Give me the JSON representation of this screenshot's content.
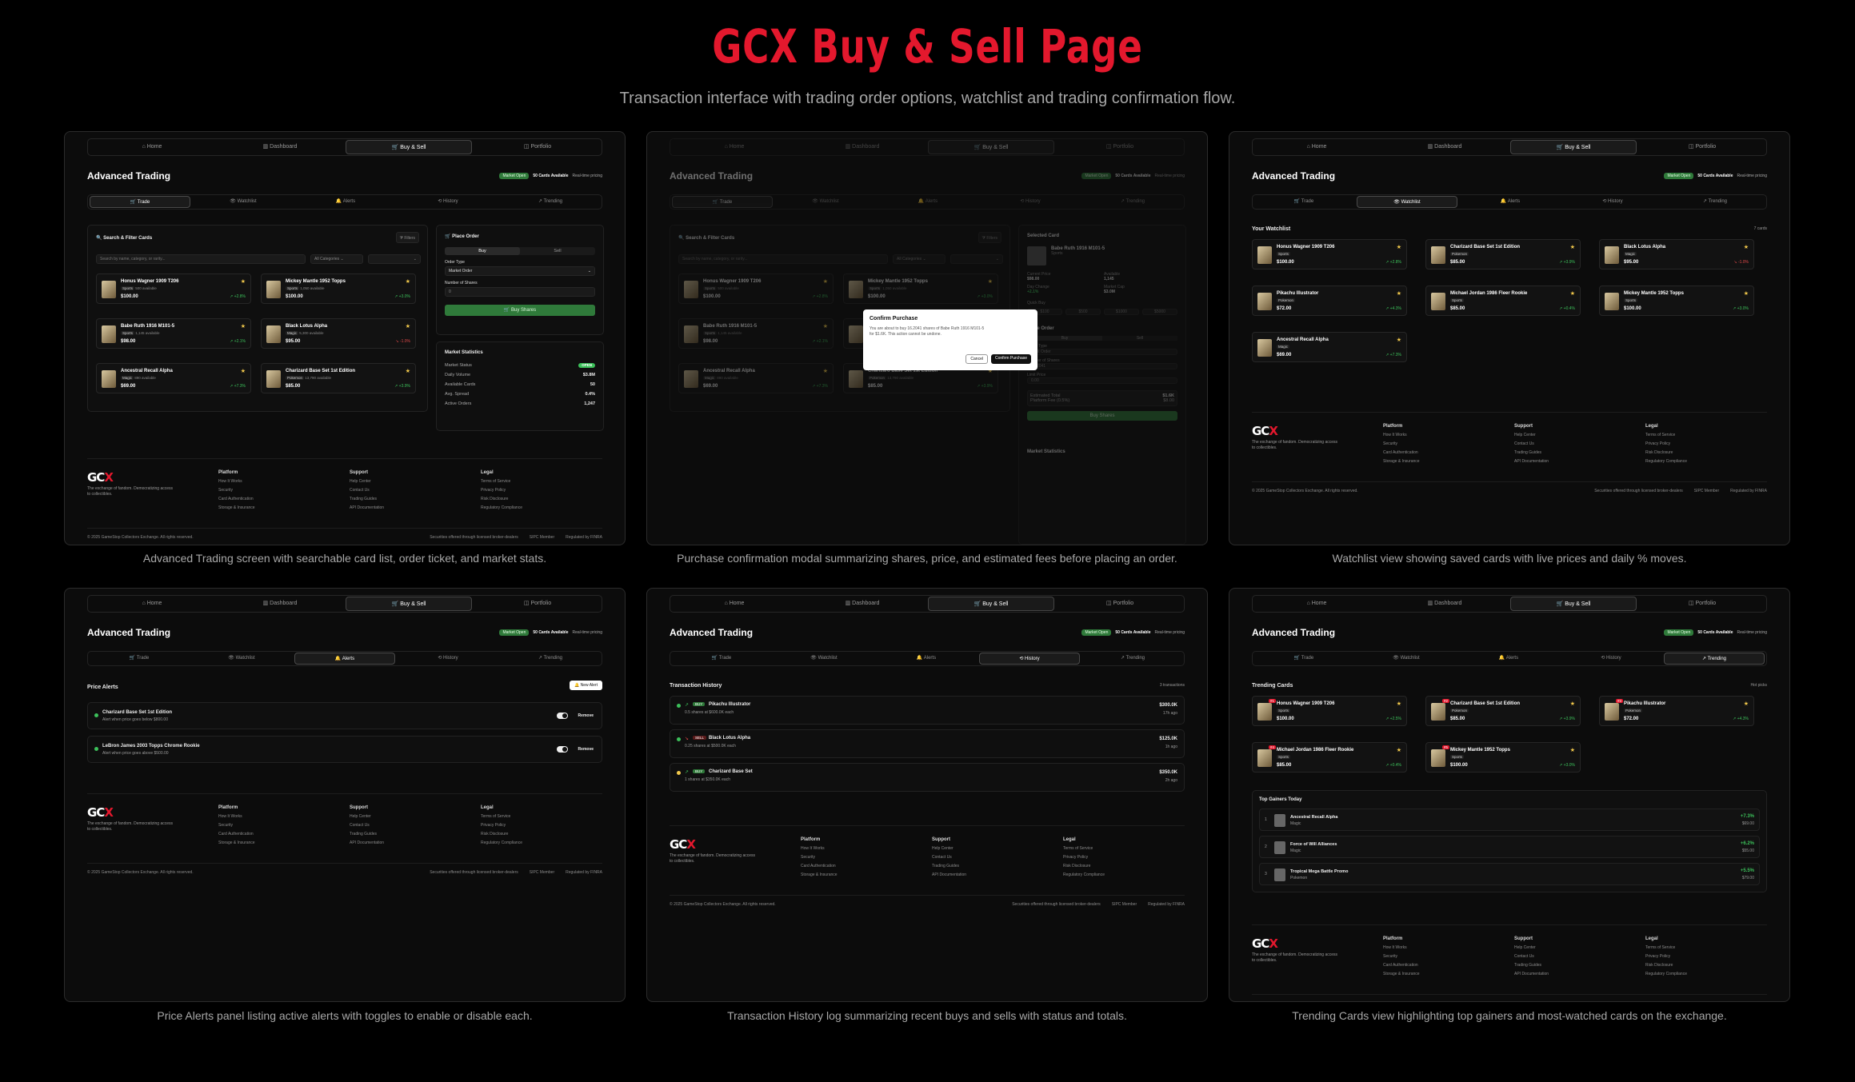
{
  "header": {
    "title": "GCX Buy & Sell Page",
    "subtitle": "Transaction interface with trading order options, watchlist and trading confirmation flow."
  },
  "nav": [
    "Home",
    "Dashboard",
    "Buy & Sell",
    "Portfolio"
  ],
  "tabs": [
    "Trade",
    "Watchlist",
    "Alerts",
    "History",
    "Trending"
  ],
  "page_title": "Advanced Trading",
  "chips": {
    "status": "Market Open",
    "cards": "50 Cards Available",
    "pricing": "Real-time pricing"
  },
  "captions": [
    "Advanced Trading screen with searchable card list, order ticket, and market stats.",
    "Purchase confirmation modal summarizing shares, price, and estimated fees before placing an order.",
    "Watchlist view showing saved cards with live prices and daily % moves.",
    "Price Alerts panel listing active alerts with toggles to enable or disable each.",
    "Transaction History log summarizing recent buys and sells with status and totals.",
    "Trending Cards view highlighting top gainers and most-watched cards on the exchange."
  ],
  "trade": {
    "search_title": "Search & Filter Cards",
    "filters": "Filters",
    "search_ph": "Search by name, category, or rarity...",
    "all_cat": "All Categories",
    "cards": [
      {
        "name": "Honus Wagner 1909 T206",
        "tag": "Sports",
        "avail": "500 available",
        "price": "$100.00",
        "chg": "↗ +2.8%"
      },
      {
        "name": "Mickey Mantle 1952 Topps",
        "tag": "Sports",
        "avail": "1,050 available",
        "price": "$100.00",
        "chg": "↗ +3.0%"
      },
      {
        "name": "Babe Ruth 1916 M101-5",
        "tag": "Sports",
        "avail": "1,145 available",
        "price": "$98.00",
        "chg": "↗ +2.1%"
      },
      {
        "name": "Black Lotus Alpha",
        "tag": "Magic",
        "avail": "5,300 available",
        "price": "$95.00",
        "chg": "↘ -1.0%"
      },
      {
        "name": "Ancestral Recall Alpha",
        "tag": "Magic",
        "avail": "890 available",
        "price": "$69.00",
        "chg": "↗ +7.3%"
      },
      {
        "name": "Charizard Base Set 1st Edition",
        "tag": "Pokemon",
        "avail": "13,790 available",
        "price": "$85.00",
        "chg": "↗ +3.9%"
      }
    ],
    "order_title": "Place Order",
    "buy": "Buy",
    "sell": "Sell",
    "order_type_label": "Order Type",
    "order_type": "Market Order",
    "shares_label": "Number of Shares",
    "shares": "0",
    "buy_btn": "Buy Shares",
    "stats_title": "Market Statistics",
    "stats": [
      {
        "k": "Market Status",
        "v": "OPEN"
      },
      {
        "k": "Daily Volume",
        "v": "$3.8M"
      },
      {
        "k": "Available Cards",
        "v": "50"
      },
      {
        "k": "Avg. Spread",
        "v": "0.4%"
      },
      {
        "k": "Active Orders",
        "v": "1,247"
      }
    ]
  },
  "modal": {
    "title": "Confirm Purchase",
    "body": "You are about to buy 16.2041 shares of Babe Ruth 1916 M101-5 for $1.6K. This action cannot be undone.",
    "cancel": "Cancel",
    "confirm": "Confirm Purchase",
    "selected": "Selected Card",
    "card": "Babe Ruth 1916 M101-5",
    "tag": "Sports",
    "cur_price": "Current Price",
    "cur_val": "$98.00",
    "avail": "Available",
    "avail_val": "1,145",
    "day": "Day Change",
    "day_val": "+2.1%",
    "mcap": "Market Cap",
    "mcap_val": "$3.0M",
    "quick": "Quick Buy",
    "quick_vals": [
      "$100",
      "$500",
      "$1000",
      "$5000"
    ],
    "limit": "Limit Order",
    "num": "Number of Shares",
    "num_val": "16.2041",
    "lim_price": "Limit Price",
    "lim_val": "0.00",
    "est": "Estimated Total",
    "est_val": "$1.6K",
    "fee": "Platform Fee (0.5%)",
    "fee_val": "$8.00"
  },
  "watch": {
    "title": "Your Watchlist",
    "count": "7 cards",
    "cards": [
      {
        "name": "Honus Wagner 1909 T206",
        "tag": "Sports",
        "price": "$100.00",
        "chg": "↗ +2.8%"
      },
      {
        "name": "Charizard Base Set 1st Edition",
        "tag": "Pokemon",
        "price": "$85.00",
        "chg": "↗ +3.9%"
      },
      {
        "name": "Black Lotus Alpha",
        "tag": "Magic",
        "price": "$95.00",
        "chg": "↘ -1.0%"
      },
      {
        "name": "Pikachu Illustrator",
        "tag": "Pokemon",
        "price": "$72.00",
        "chg": "↗ +4.3%"
      },
      {
        "name": "Michael Jordan 1986 Fleer Rookie",
        "tag": "Sports",
        "price": "$85.00",
        "chg": "↗ +0.4%"
      },
      {
        "name": "Mickey Mantle 1952 Topps",
        "tag": "Sports",
        "price": "$100.00",
        "chg": "↗ +3.0%"
      },
      {
        "name": "Ancestral Recall Alpha",
        "tag": "Magic",
        "price": "$69.00",
        "chg": "↗ +7.3%"
      }
    ]
  },
  "alerts": {
    "title": "Price Alerts",
    "new": "New Alert",
    "remove": "Remove",
    "items": [
      {
        "name": "Charizard Base Set 1st Edition",
        "sub": "Alert when price goes below $800.00"
      },
      {
        "name": "LeBron James 2003 Topps Chrome Rookie",
        "sub": "Alert when price goes above $500.00"
      }
    ]
  },
  "history": {
    "title": "Transaction History",
    "count": "3 transactions",
    "items": [
      {
        "type": "BUY",
        "name": "Pikachu Illustrator",
        "sub": "0.5 shares at $600.0K each",
        "total": "$300.0K",
        "ago": "17h ago"
      },
      {
        "type": "SELL",
        "name": "Black Lotus Alpha",
        "sub": "0.25 shares at $500.0K each",
        "total": "$125.0K",
        "ago": "1h ago"
      },
      {
        "type": "BUY",
        "name": "Charizard Base Set",
        "sub": "1 shares at $350.0K each",
        "total": "$350.0K",
        "ago": "2h ago"
      }
    ]
  },
  "trending": {
    "title": "Trending Cards",
    "hot": "Hot picks",
    "cards": [
      {
        "rank": "#1",
        "name": "Honus Wagner 1909 T206",
        "tag": "Sports",
        "price": "$100.00",
        "chg": "↗ +2.5%"
      },
      {
        "rank": "#2",
        "name": "Charizard Base Set 1st Edition",
        "tag": "Pokemon",
        "price": "$85.00",
        "chg": "↗ +3.9%"
      },
      {
        "rank": "#3",
        "name": "Pikachu Illustrator",
        "tag": "Pokemon",
        "price": "$72.00",
        "chg": "↗ +4.3%"
      },
      {
        "rank": "#4",
        "name": "Michael Jordan 1986 Fleer Rookie",
        "tag": "Sports",
        "price": "$85.00",
        "chg": "↗ +0.4%"
      },
      {
        "rank": "#5",
        "name": "Mickey Mantle 1952 Topps",
        "tag": "Sports",
        "price": "$100.00",
        "chg": "↗ +3.0%"
      }
    ],
    "gainers_title": "Top Gainers Today",
    "gainers": [
      {
        "n": "1",
        "name": "Ancestral Recall Alpha",
        "tag": "Magic",
        "chg": "+7.3%",
        "price": "$69.00"
      },
      {
        "n": "2",
        "name": "Force of Will Alliances",
        "tag": "Magic",
        "chg": "+6.2%",
        "price": "$55.00"
      },
      {
        "n": "3",
        "name": "Tropical Mega Battle Promo",
        "tag": "Pokemon",
        "chg": "+5.5%",
        "price": "$79.00"
      }
    ]
  },
  "footer": {
    "logo_a": "GC",
    "logo_b": "X",
    "tagline": "The exchange of fandom. Democratizing access to collectibles.",
    "cols": [
      {
        "h": "Platform",
        "items": [
          "How It Works",
          "Security",
          "Card Authentication",
          "Storage & Insurance"
        ]
      },
      {
        "h": "Support",
        "items": [
          "Help Center",
          "Contact Us",
          "Trading Guides",
          "API Documentation"
        ]
      },
      {
        "h": "Legal",
        "items": [
          "Terms of Service",
          "Privacy Policy",
          "Risk Disclosure",
          "Regulatory Compliance"
        ]
      }
    ],
    "copy": "© 2025 GameStop Collectors Exchange. All rights reserved.",
    "securities": "Securities offered through licensed broker-dealers",
    "sipc": "SIPC Member",
    "finra": "Regulated by FINRA"
  }
}
